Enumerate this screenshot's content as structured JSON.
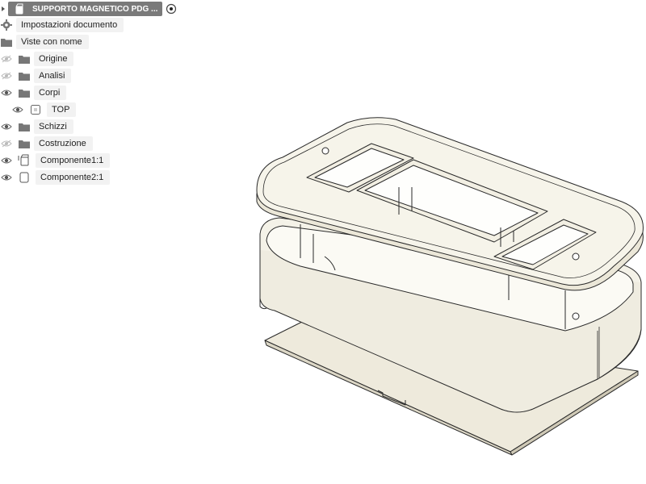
{
  "browser": {
    "root_title": "SUPPORTO MAGNETICO PDG ...",
    "document_settings": "Impostazioni documento",
    "named_views": "Viste con nome",
    "folders": [
      {
        "label": "Origine",
        "eye": "eye-hidden-icon"
      },
      {
        "label": "Analisi",
        "eye": "eye-hidden-icon"
      },
      {
        "label": "Corpi",
        "eye": "eye-visible-icon"
      },
      {
        "label": "TOP",
        "eye": "eye-visible-icon"
      },
      {
        "label": "Schizzi",
        "eye": "eye-visible-icon"
      },
      {
        "label": "Costruzione",
        "eye": "eye-hidden-icon"
      }
    ],
    "components": [
      {
        "label": "Componente1:1"
      },
      {
        "label": "Componente2:1"
      }
    ]
  },
  "colors": {
    "part_fill": "#f3f1e6",
    "part_edge": "#2a2a2a",
    "chip_bg": "#f2f2f2",
    "root_bg": "#7a7a7a"
  }
}
